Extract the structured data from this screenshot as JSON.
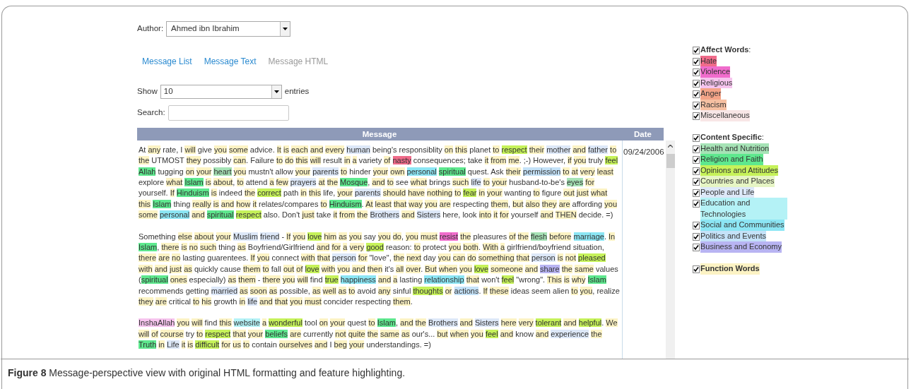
{
  "author": {
    "label": "Author:",
    "value": "Ahmed ibn Ibrahim"
  },
  "tabs": [
    {
      "label": "Message List",
      "selected": false
    },
    {
      "label": "Message Text",
      "selected": false
    },
    {
      "label": "Message HTML",
      "selected": true
    }
  ],
  "length": {
    "label": "Show",
    "value": "10",
    "suffix": "entries"
  },
  "search": {
    "label": "Search:"
  },
  "table": {
    "columns": [
      "Message",
      "Date"
    ],
    "rows": [
      {
        "date": "09/24/2006",
        "paragraphs": [
          [
            "At",
            {
              "text": "any",
              "color": "#fcf3c4"
            },
            "rate, I",
            {
              "text": "will",
              "color": "#fcf3c4"
            },
            "give",
            {
              "text": "you",
              "color": "#fcf3c4"
            },
            {
              "text": "some",
              "color": "#fcf3c4"
            },
            "advice.",
            {
              "text": "It",
              "color": "#fcf3c4"
            },
            {
              "text": "is",
              "color": "#fcf3c4"
            },
            {
              "text": "each",
              "color": "#fcf3c4"
            },
            {
              "text": "and",
              "color": "#fcf3c4"
            },
            {
              "text": "every",
              "color": "#fcf3c4"
            },
            {
              "text": "human",
              "color": "#dde8f8"
            },
            "being's responsiblity",
            {
              "text": "on",
              "color": "#fcf3c4"
            },
            {
              "text": "this",
              "color": "#fcf3c4"
            },
            "planet",
            {
              "text": "to",
              "color": "#fcf3c4"
            },
            {
              "text": "respect",
              "color": "#c6f25a"
            },
            {
              "text": "their",
              "color": "#fcf3c4"
            },
            {
              "text": "mother",
              "color": "#dde8f8"
            },
            {
              "text": "and",
              "color": "#fcf3c4"
            },
            {
              "text": "father",
              "color": "#dde8f8"
            },
            {
              "text": "to",
              "color": "#fcf3c4"
            },
            {
              "text": "the",
              "color": "#fcf3c4"
            },
            "UTMOST",
            {
              "text": "they",
              "color": "#fcf3c4"
            },
            "possibly",
            {
              "text": "can",
              "color": "#fcf3c4",
              "after": "."
            },
            "Failure",
            {
              "text": "to",
              "color": "#fcf3c4"
            },
            {
              "text": "do",
              "color": "#fcf3c4"
            },
            {
              "text": "this",
              "color": "#fcf3c4"
            },
            {
              "text": "will",
              "color": "#fcf3c4"
            },
            "result",
            {
              "text": "in",
              "color": "#fcf3c4"
            },
            {
              "text": "a",
              "color": "#fcf3c4"
            },
            "variety",
            {
              "text": "of",
              "color": "#fcf3c4"
            },
            {
              "text": "nasty",
              "color": "#f06b8a"
            },
            "consequences; take",
            {
              "text": "it",
              "color": "#fcf3c4"
            },
            {
              "text": "from",
              "color": "#fcf3c4"
            },
            {
              "text": "me",
              "color": "#fcf3c4",
              "after": "."
            },
            ";-) However,",
            {
              "text": "if",
              "color": "#fcf3c4"
            },
            {
              "text": "you",
              "color": "#fcf3c4"
            },
            "truly",
            {
              "text": "feel",
              "color": "#c6f25a"
            },
            {
              "text": "Allah",
              "color": "#5ee88e"
            },
            "tugging",
            {
              "text": "on",
              "color": "#fcf3c4"
            },
            {
              "text": "your",
              "color": "#fcf3c4"
            },
            {
              "text": "heart",
              "color": "#a6e3b6"
            },
            {
              "text": "you",
              "color": "#fcf3c4"
            },
            "mustn't allow",
            {
              "text": "your",
              "color": "#fcf3c4"
            },
            {
              "text": "parents",
              "color": "#dde8f8"
            },
            {
              "text": "to",
              "color": "#fcf3c4"
            },
            "hinder",
            {
              "text": "your",
              "color": "#fcf3c4"
            },
            {
              "text": "own",
              "color": "#fcf3c4"
            },
            {
              "text": "personal",
              "color": "#8ce6f4"
            },
            {
              "text": "spiritual",
              "color": "#5ee88e"
            },
            "quest. Ask",
            {
              "text": "their",
              "color": "#fcf3c4"
            },
            {
              "text": "permission",
              "color": "#c4e2f8"
            },
            {
              "text": "to",
              "color": "#fcf3c4"
            },
            {
              "text": "at",
              "color": "#fcf3c4"
            },
            {
              "text": "very",
              "color": "#fcf3c4"
            },
            {
              "text": "least",
              "color": "#fcf3c4"
            },
            "explore",
            {
              "text": "what",
              "color": "#fcf3c4"
            },
            {
              "text": "Islam",
              "color": "#5ee88e"
            },
            {
              "text": "is",
              "color": "#fcf3c4"
            },
            {
              "text": "about",
              "color": "#fcf3c4",
              "after": ","
            },
            {
              "text": "to",
              "color": "#fcf3c4"
            },
            "attend",
            {
              "text": "a",
              "color": "#fcf3c4"
            },
            {
              "text": "few",
              "color": "#fcf3c4"
            },
            {
              "text": "prayers",
              "color": "#dde8f8"
            },
            {
              "text": "at",
              "color": "#fcf3c4"
            },
            {
              "text": "the",
              "color": "#fcf3c4"
            },
            {
              "text": "Mosque",
              "color": "#5ee88e",
              "after": ","
            },
            {
              "text": "and",
              "color": "#fcf3c4"
            },
            {
              "text": "to",
              "color": "#fcf3c4"
            },
            "see",
            {
              "text": "what",
              "color": "#fcf3c4"
            },
            "brings",
            {
              "text": "such",
              "color": "#fcf3c4"
            },
            {
              "text": "life",
              "color": "#dde8f8"
            },
            {
              "text": "to",
              "color": "#fcf3c4"
            },
            {
              "text": "your",
              "color": "#fcf3c4"
            },
            "husband-to-be's",
            {
              "text": "eyes",
              "color": "#a6e3b6"
            },
            {
              "text": "for",
              "color": "#fcf3c4"
            },
            "yourself.",
            {
              "text": "If",
              "color": "#fcf3c4"
            },
            {
              "text": "Hinduism",
              "color": "#5ee88e"
            },
            {
              "text": "is",
              "color": "#fcf3c4"
            },
            "indeed",
            {
              "text": "the",
              "color": "#fcf3c4"
            },
            {
              "text": "correct",
              "color": "#c6f25a"
            },
            "path",
            {
              "text": "in",
              "color": "#fcf3c4"
            },
            {
              "text": "this",
              "color": "#fcf3c4"
            },
            "life,",
            {
              "text": "your",
              "color": "#fcf3c4"
            },
            {
              "text": "parents",
              "color": "#dde8f8"
            },
            {
              "text": "should",
              "color": "#fcf3c4"
            },
            {
              "text": "have",
              "color": "#fcf3c4"
            },
            {
              "text": "nothing",
              "color": "#fcf3c4"
            },
            {
              "text": "to",
              "color": "#fcf3c4"
            },
            {
              "text": "fear",
              "color": "#c6f25a"
            },
            {
              "text": "in",
              "color": "#fcf3c4"
            },
            {
              "text": "your",
              "color": "#fcf3c4"
            },
            "wanting",
            {
              "text": "to",
              "color": "#fcf3c4"
            },
            "figure",
            {
              "text": "out",
              "color": "#fcf3c4"
            },
            {
              "text": "just",
              "color": "#fcf3c4"
            },
            {
              "text": "what",
              "color": "#fcf3c4"
            },
            {
              "text": "this",
              "color": "#fcf3c4"
            },
            {
              "text": "Islam",
              "color": "#5ee88e"
            },
            "thing",
            {
              "text": "really",
              "color": "#fcf3c4"
            },
            {
              "text": "is",
              "color": "#fcf3c4"
            },
            {
              "text": "and",
              "color": "#fcf3c4"
            },
            {
              "text": "how",
              "color": "#fcf3c4"
            },
            {
              "text": "it",
              "color": "#fcf3c4"
            },
            "relates/compares",
            {
              "text": "to",
              "color": "#fcf3c4"
            },
            {
              "text": "Hinduism",
              "color": "#5ee88e",
              "after": "."
            },
            {
              "text": "At",
              "color": "#fcf3c4"
            },
            {
              "text": "least",
              "color": "#fcf3c4"
            },
            {
              "text": "that",
              "color": "#fcf3c4"
            },
            {
              "text": "way",
              "color": "#fcf3c4"
            },
            {
              "text": "you",
              "color": "#fcf3c4"
            },
            {
              "text": "are",
              "color": "#fcf3c4"
            },
            "respecting",
            {
              "text": "them",
              "color": "#fcf3c4",
              "after": ","
            },
            {
              "text": "but",
              "color": "#fcf3c4"
            },
            {
              "text": "also",
              "color": "#fcf3c4"
            },
            {
              "text": "they",
              "color": "#fcf3c4"
            },
            {
              "text": "are",
              "color": "#fcf3c4"
            },
            "affording",
            {
              "text": "you",
              "color": "#fcf3c4"
            },
            {
              "text": "some",
              "color": "#fcf3c4"
            },
            {
              "text": "personal",
              "color": "#8ce6f4"
            },
            {
              "text": "and",
              "color": "#fcf3c4"
            },
            {
              "text": "spiritual",
              "color": "#5ee88e"
            },
            {
              "text": "respect",
              "color": "#c6f25a"
            },
            "also. Don't",
            {
              "text": "just",
              "color": "#fcf3c4"
            },
            "take",
            {
              "text": "it",
              "color": "#fcf3c4"
            },
            {
              "text": "from",
              "color": "#fcf3c4"
            },
            {
              "text": "the",
              "color": "#fcf3c4"
            },
            {
              "text": "Brothers",
              "color": "#dde8f8"
            },
            {
              "text": "and",
              "color": "#fcf3c4"
            },
            {
              "text": "Sisters",
              "color": "#dde8f8"
            },
            "here, look",
            {
              "text": "into",
              "color": "#fcf3c4"
            },
            {
              "text": "it",
              "color": "#fcf3c4"
            },
            {
              "text": "for",
              "color": "#fcf3c4"
            },
            "yourself",
            {
              "text": "and",
              "color": "#fcf3c4"
            },
            {
              "text": "THEN",
              "color": "#fcf3c4"
            },
            "decide. =)"
          ],
          [
            "Something",
            {
              "text": "else",
              "color": "#fcf3c4"
            },
            {
              "text": "about",
              "color": "#fcf3c4"
            },
            {
              "text": "your",
              "color": "#fcf3c4"
            },
            {
              "text": "Muslim",
              "color": "#dde8f8"
            },
            {
              "text": "friend",
              "color": "#dde8f8"
            },
            "-",
            {
              "text": "If",
              "color": "#fcf3c4"
            },
            {
              "text": "you",
              "color": "#fcf3c4"
            },
            {
              "text": "love",
              "color": "#c6f25a"
            },
            {
              "text": "him",
              "color": "#fcf3c4"
            },
            {
              "text": "as",
              "color": "#fcf3c4"
            },
            {
              "text": "you",
              "color": "#fcf3c4"
            },
            "say",
            {
              "text": "you",
              "color": "#fcf3c4"
            },
            {
              "text": "do",
              "color": "#fcf3c4",
              "after": ","
            },
            {
              "text": "you",
              "color": "#fcf3c4"
            },
            {
              "text": "must",
              "color": "#fcf3c4"
            },
            {
              "text": "resist",
              "color": "#f06ccc"
            },
            {
              "text": "the",
              "color": "#fcf3c4"
            },
            "pleasures",
            {
              "text": "of",
              "color": "#fcf3c4"
            },
            {
              "text": "the",
              "color": "#fcf3c4"
            },
            {
              "text": "flesh",
              "color": "#a6e3b6"
            },
            {
              "text": "before",
              "color": "#fcf3c4"
            },
            {
              "text": "marriage",
              "color": "#8ce6f4",
              "after": "."
            },
            {
              "text": "In",
              "color": "#fcf3c4"
            },
            {
              "text": "Islam",
              "color": "#5ee88e",
              "after": ","
            },
            {
              "text": "there",
              "color": "#fcf3c4"
            },
            {
              "text": "is",
              "color": "#fcf3c4"
            },
            {
              "text": "no",
              "color": "#fcf3c4"
            },
            {
              "text": "such",
              "color": "#fcf3c4"
            },
            "thing",
            {
              "text": "as",
              "color": "#fcf3c4"
            },
            "Boyfriend/Girlfriend",
            {
              "text": "and",
              "color": "#fcf3c4"
            },
            {
              "text": "for",
              "color": "#fcf3c4"
            },
            {
              "text": "a",
              "color": "#fcf3c4"
            },
            {
              "text": "very",
              "color": "#fcf3c4"
            },
            {
              "text": "good",
              "color": "#c6f25a"
            },
            "reason:",
            {
              "text": "to",
              "color": "#fcf3c4"
            },
            "protect",
            {
              "text": "you",
              "color": "#fcf3c4"
            },
            {
              "text": "both",
              "color": "#fcf3c4",
              "after": "."
            },
            {
              "text": "With",
              "color": "#fcf3c4"
            },
            {
              "text": "a",
              "color": "#fcf3c4"
            },
            "girlfriend/boyfriend situation,",
            {
              "text": "there",
              "color": "#fcf3c4"
            },
            {
              "text": "are",
              "color": "#fcf3c4"
            },
            {
              "text": "no",
              "color": "#fcf3c4"
            },
            "lasting guarentees.",
            {
              "text": "If",
              "color": "#fcf3c4"
            },
            {
              "text": "you",
              "color": "#fcf3c4"
            },
            "connect",
            {
              "text": "with",
              "color": "#fcf3c4"
            },
            {
              "text": "that",
              "color": "#fcf3c4"
            },
            {
              "text": "person",
              "color": "#dde8f8"
            },
            {
              "text": "for",
              "color": "#fcf3c4"
            },
            "\"love\",",
            {
              "text": "the",
              "color": "#fcf3c4"
            },
            {
              "text": "next",
              "color": "#fcf3c4"
            },
            "day",
            {
              "text": "you",
              "color": "#fcf3c4"
            },
            {
              "text": "can",
              "color": "#fcf3c4"
            },
            {
              "text": "do",
              "color": "#fcf3c4"
            },
            {
              "text": "something",
              "color": "#fcf3c4"
            },
            {
              "text": "that",
              "color": "#fcf3c4"
            },
            {
              "text": "person",
              "color": "#dde8f8"
            },
            {
              "text": "is",
              "color": "#fcf3c4"
            },
            {
              "text": "not",
              "color": "#fcf3c4"
            },
            {
              "text": "pleased",
              "color": "#c6f25a"
            },
            {
              "text": "with",
              "color": "#fcf3c4"
            },
            {
              "text": "and",
              "color": "#fcf3c4"
            },
            {
              "text": "just",
              "color": "#fcf3c4"
            },
            {
              "text": "as",
              "color": "#fcf3c4"
            },
            "quickly cause",
            {
              "text": "them",
              "color": "#fcf3c4"
            },
            {
              "text": "to",
              "color": "#fcf3c4"
            },
            "fall",
            {
              "text": "out",
              "color": "#fcf3c4"
            },
            {
              "text": "of",
              "color": "#fcf3c4"
            },
            {
              "text": "love",
              "color": "#c6f25a"
            },
            {
              "text": "with",
              "color": "#fcf3c4"
            },
            {
              "text": "you",
              "color": "#fcf3c4"
            },
            {
              "text": "and",
              "color": "#fcf3c4"
            },
            {
              "text": "then",
              "color": "#fcf3c4"
            },
            "it's",
            {
              "text": "all",
              "color": "#fcf3c4"
            },
            {
              "text": "over",
              "color": "#fcf3c4",
              "after": "."
            },
            {
              "text": "But",
              "color": "#fcf3c4"
            },
            {
              "text": "when",
              "color": "#fcf3c4"
            },
            {
              "text": "you",
              "color": "#fcf3c4"
            },
            {
              "text": "love",
              "color": "#c6f25a"
            },
            {
              "text": "someone",
              "color": "#fcf3c4"
            },
            {
              "text": "and",
              "color": "#fcf3c4"
            },
            {
              "text": "share",
              "color": "#b8b4f2"
            },
            {
              "text": "the",
              "color": "#fcf3c4"
            },
            {
              "text": "same",
              "color": "#fcf3c4"
            },
            "values",
            {
              "before": "(",
              "text": "spiritual",
              "color": "#5ee88e"
            },
            {
              "text": "ones",
              "color": "#fcf3c4"
            },
            "especially)",
            {
              "text": "as",
              "color": "#fcf3c4"
            },
            {
              "text": "them",
              "color": "#fcf3c4"
            },
            "-",
            {
              "text": "there",
              "color": "#fcf3c4"
            },
            {
              "text": "you",
              "color": "#fcf3c4"
            },
            {
              "text": "will",
              "color": "#fcf3c4"
            },
            "find",
            {
              "text": "true",
              "color": "#c6f25a"
            },
            {
              "text": "happiness",
              "color": "#8ce6f4"
            },
            {
              "text": "and",
              "color": "#fcf3c4"
            },
            {
              "text": "a",
              "color": "#fcf3c4"
            },
            "lasting",
            {
              "text": "relationship",
              "color": "#8ce6f4"
            },
            {
              "text": "that",
              "color": "#fcf3c4"
            },
            "won't",
            {
              "text": "feel",
              "color": "#c6f25a"
            },
            "\"wrong\".",
            {
              "text": "This",
              "color": "#fcf3c4"
            },
            {
              "text": "is",
              "color": "#fcf3c4"
            },
            {
              "text": "why",
              "color": "#fcf3c4"
            },
            {
              "text": "Islam",
              "color": "#5ee88e"
            },
            "recommends getting",
            {
              "text": "married",
              "color": "#dde8f8"
            },
            {
              "text": "as",
              "color": "#fcf3c4"
            },
            {
              "text": "soon",
              "color": "#fcf3c4"
            },
            {
              "text": "as",
              "color": "#fcf3c4"
            },
            "possible,",
            {
              "text": "as",
              "color": "#fcf3c4"
            },
            {
              "text": "well",
              "color": "#fcf3c4"
            },
            {
              "text": "as",
              "color": "#fcf3c4"
            },
            {
              "text": "to",
              "color": "#fcf3c4"
            },
            "avoid",
            {
              "text": "any",
              "color": "#fcf3c4"
            },
            "sinful",
            {
              "text": "thoughts",
              "color": "#c6f25a"
            },
            {
              "text": "or",
              "color": "#fcf3c4"
            },
            {
              "text": "actions",
              "color": "#c4e2f8",
              "after": "."
            },
            {
              "text": "If",
              "color": "#fcf3c4"
            },
            {
              "text": "these",
              "color": "#fcf3c4"
            },
            "ideas seem alien",
            {
              "text": "to",
              "color": "#fcf3c4"
            },
            {
              "text": "you",
              "color": "#fcf3c4",
              "after": ","
            },
            "realize",
            {
              "text": "they",
              "color": "#fcf3c4"
            },
            {
              "text": "are",
              "color": "#fcf3c4"
            },
            "critical",
            {
              "text": "to",
              "color": "#fcf3c4"
            },
            {
              "text": "his",
              "color": "#fcf3c4"
            },
            "growth",
            {
              "text": "in",
              "color": "#fcf3c4"
            },
            {
              "text": "life",
              "color": "#dde8f8"
            },
            {
              "text": "and",
              "color": "#fcf3c4"
            },
            {
              "text": "that",
              "color": "#fcf3c4"
            },
            {
              "text": "you",
              "color": "#fcf3c4"
            },
            {
              "text": "must",
              "color": "#fcf3c4"
            },
            "concider respecting",
            {
              "text": "them",
              "color": "#fcf3c4",
              "after": "."
            }
          ],
          [
            {
              "text": "InshaAllah",
              "color": "#f6c4ee"
            },
            {
              "text": "you",
              "color": "#fcf3c4"
            },
            {
              "text": "will",
              "color": "#fcf3c4"
            },
            "find",
            {
              "text": "this",
              "color": "#fcf3c4"
            },
            {
              "text": "website",
              "color": "#b4f2f6"
            },
            {
              "text": "a",
              "color": "#fcf3c4"
            },
            {
              "text": "wonderful",
              "color": "#c6f25a"
            },
            "tool",
            {
              "text": "on",
              "color": "#fcf3c4"
            },
            {
              "text": "your",
              "color": "#fcf3c4"
            },
            "quest",
            {
              "text": "to",
              "color": "#fcf3c4"
            },
            {
              "text": "Islam",
              "color": "#5ee88e",
              "after": ","
            },
            {
              "text": "and",
              "color": "#fcf3c4"
            },
            {
              "text": "the",
              "color": "#fcf3c4"
            },
            {
              "text": "Brothers",
              "color": "#dde8f8"
            },
            {
              "text": "and",
              "color": "#fcf3c4"
            },
            {
              "text": "Sisters",
              "color": "#dde8f8"
            },
            {
              "text": "here",
              "color": "#fcf3c4"
            },
            {
              "text": "very",
              "color": "#fcf3c4"
            },
            {
              "text": "tolerant",
              "color": "#c6f25a"
            },
            {
              "text": "and",
              "color": "#fcf3c4"
            },
            {
              "text": "helpful",
              "color": "#c6f25a",
              "after": "."
            },
            {
              "text": "We",
              "color": "#fcf3c4"
            },
            {
              "text": "will",
              "color": "#fcf3c4"
            },
            {
              "text": "of",
              "color": "#fcf3c4"
            },
            {
              "text": "course",
              "color": "#fcf3c4"
            },
            "try",
            {
              "text": "to",
              "color": "#fcf3c4"
            },
            {
              "text": "respect",
              "color": "#c6f25a"
            },
            {
              "text": "that",
              "color": "#fcf3c4"
            },
            {
              "text": "your",
              "color": "#fcf3c4"
            },
            {
              "text": "beliefs",
              "color": "#5ee88e"
            },
            {
              "text": "are",
              "color": "#fcf3c4"
            },
            "currently",
            {
              "text": "not",
              "color": "#fcf3c4"
            },
            {
              "text": "quite",
              "color": "#fcf3c4"
            },
            {
              "text": "the",
              "color": "#fcf3c4"
            },
            {
              "text": "same",
              "color": "#fcf3c4"
            },
            {
              "text": "as",
              "color": "#fcf3c4"
            },
            "our's...",
            {
              "text": "but",
              "color": "#fcf3c4"
            },
            {
              "text": "when",
              "color": "#fcf3c4"
            },
            {
              "text": "you",
              "color": "#fcf3c4"
            },
            {
              "text": "feel",
              "color": "#c6f25a"
            },
            {
              "text": "and",
              "color": "#fcf3c4"
            },
            "know",
            {
              "text": "and",
              "color": "#fcf3c4"
            },
            {
              "text": "experience",
              "color": "#dde8f8"
            },
            {
              "text": "the",
              "color": "#fcf3c4"
            },
            {
              "text": "Truth",
              "color": "#5ee88e"
            },
            {
              "text": "in",
              "color": "#fcf3c4"
            },
            {
              "text": "Life",
              "color": "#dde8f8"
            },
            {
              "text": "it",
              "color": "#fcf3c4"
            },
            {
              "text": "is",
              "color": "#fcf3c4"
            },
            {
              "text": "difficult",
              "color": "#c6f25a"
            },
            {
              "text": "for",
              "color": "#fcf3c4"
            },
            {
              "text": "us",
              "color": "#fcf3c4"
            },
            {
              "text": "to",
              "color": "#fcf3c4"
            },
            "contain",
            {
              "text": "ourselves",
              "color": "#fcf3c4"
            },
            {
              "text": "and",
              "color": "#fcf3c4"
            },
            "I",
            {
              "text": "beg",
              "color": "#fcf3c4"
            },
            {
              "text": "your",
              "color": "#fcf3c4"
            },
            "understandings. =)"
          ]
        ]
      }
    ]
  },
  "filters": [
    {
      "label": "**Affect Words**:",
      "checked": true,
      "items": [
        {
          "label": "Hate",
          "checked": true,
          "color": "#f06b8a"
        },
        {
          "label": "Violence",
          "checked": true,
          "color": "#f06ccc"
        },
        {
          "label": "Religious",
          "checked": true,
          "color": "#f6c4ee"
        },
        {
          "label": "Anger",
          "checked": true,
          "color": "#f4a488"
        },
        {
          "label": "Racism",
          "checked": true,
          "color": "#f6c0a2"
        },
        {
          "label": "Miscellaneous",
          "checked": true,
          "color": "#f8e6e6"
        }
      ]
    },
    {
      "label": "**Content Specific**:",
      "checked": true,
      "items": [
        {
          "label": "Health and Nutrition",
          "checked": true,
          "color": "#a6e3b6"
        },
        {
          "label": "Religion and Faith",
          "checked": true,
          "color": "#5ee88e"
        },
        {
          "label": "Opinions and Attitudes",
          "checked": true,
          "color": "#c6f25a"
        },
        {
          "label": "Countries and Places",
          "checked": true,
          "color": "#e6f5c4"
        },
        {
          "label": "People and Life",
          "checked": true,
          "color": "#dde8f8"
        },
        {
          "label": "Education and Technologies",
          "checked": true,
          "color": "#b4f2f6"
        },
        {
          "label": "Social and Communities",
          "checked": true,
          "color": "#8ce6f4"
        },
        {
          "label": "Politics and Events",
          "checked": true,
          "color": "#c4e2f8"
        },
        {
          "label": "Business and Economy",
          "checked": true,
          "color": "#b8b4f2"
        }
      ]
    },
    {
      "label": "**Function Words**",
      "checked": true,
      "color": "#fcf3c4"
    }
  ],
  "caption": "**Figure 8** Message-perspective view with original HTML formatting and feature highlighting."
}
